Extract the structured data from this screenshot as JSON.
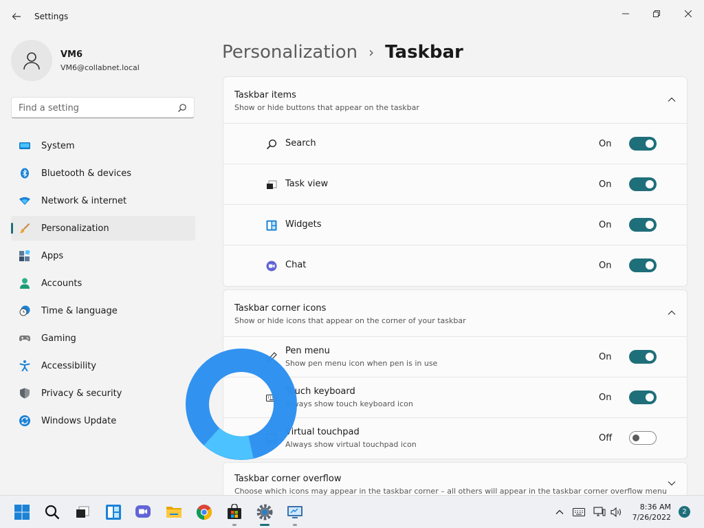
{
  "window": {
    "title": "Settings"
  },
  "user": {
    "name": "VM6",
    "email": "VM6@collabnet.local"
  },
  "search": {
    "placeholder": "Find a setting"
  },
  "nav": {
    "items": [
      {
        "label": "System",
        "icon": "monitor-icon"
      },
      {
        "label": "Bluetooth & devices",
        "icon": "bluetooth-icon"
      },
      {
        "label": "Network & internet",
        "icon": "wifi-icon"
      },
      {
        "label": "Personalization",
        "icon": "paintbrush-icon",
        "active": true
      },
      {
        "label": "Apps",
        "icon": "apps-icon"
      },
      {
        "label": "Accounts",
        "icon": "person-icon"
      },
      {
        "label": "Time & language",
        "icon": "clock-globe-icon"
      },
      {
        "label": "Gaming",
        "icon": "gamepad-icon"
      },
      {
        "label": "Accessibility",
        "icon": "accessibility-icon"
      },
      {
        "label": "Privacy & security",
        "icon": "shield-icon"
      },
      {
        "label": "Windows Update",
        "icon": "update-icon"
      }
    ]
  },
  "breadcrumb": {
    "parent": "Personalization",
    "separator": "›",
    "current": "Taskbar"
  },
  "sections": {
    "taskbar_items": {
      "title": "Taskbar items",
      "subtitle": "Show or hide buttons that appear on the taskbar",
      "rows": [
        {
          "label": "Search",
          "state": "On",
          "icon": "search-icon"
        },
        {
          "label": "Task view",
          "state": "On",
          "icon": "task-view-icon"
        },
        {
          "label": "Widgets",
          "state": "On",
          "icon": "widgets-icon"
        },
        {
          "label": "Chat",
          "state": "On",
          "icon": "chat-icon"
        }
      ]
    },
    "corner_icons": {
      "title": "Taskbar corner icons",
      "subtitle": "Show or hide icons that appear on the corner of your taskbar",
      "rows": [
        {
          "label": "Pen menu",
          "sub": "Show pen menu icon when pen is in use",
          "state": "On",
          "icon": "pen-icon"
        },
        {
          "label": "Touch keyboard",
          "sub": "Always show touch keyboard icon",
          "state": "On",
          "icon": "keyboard-icon"
        },
        {
          "label": "Virtual touchpad",
          "sub": "Always show virtual touchpad icon",
          "state": "Off",
          "icon": "touchpad-icon"
        }
      ]
    },
    "corner_overflow": {
      "title": "Taskbar corner overflow",
      "subtitle": "Choose which icons may appear in the taskbar corner – all others will appear in the taskbar corner overflow menu"
    }
  },
  "taskbar": {
    "apps": [
      "start-icon",
      "search-icon",
      "task-view-icon",
      "widgets-icon",
      "chat-icon",
      "file-explorer-icon",
      "chrome-icon",
      "store-icon",
      "settings-icon",
      "remote-desktop-icon"
    ],
    "clock": {
      "time": "8:36 AM",
      "date": "7/26/2022"
    },
    "notifications": "2"
  },
  "colors": {
    "accent": "#1f6f7a",
    "background": "#f3f3f3",
    "card": "#fbfbfb",
    "spinner": "#2b8ef0"
  }
}
